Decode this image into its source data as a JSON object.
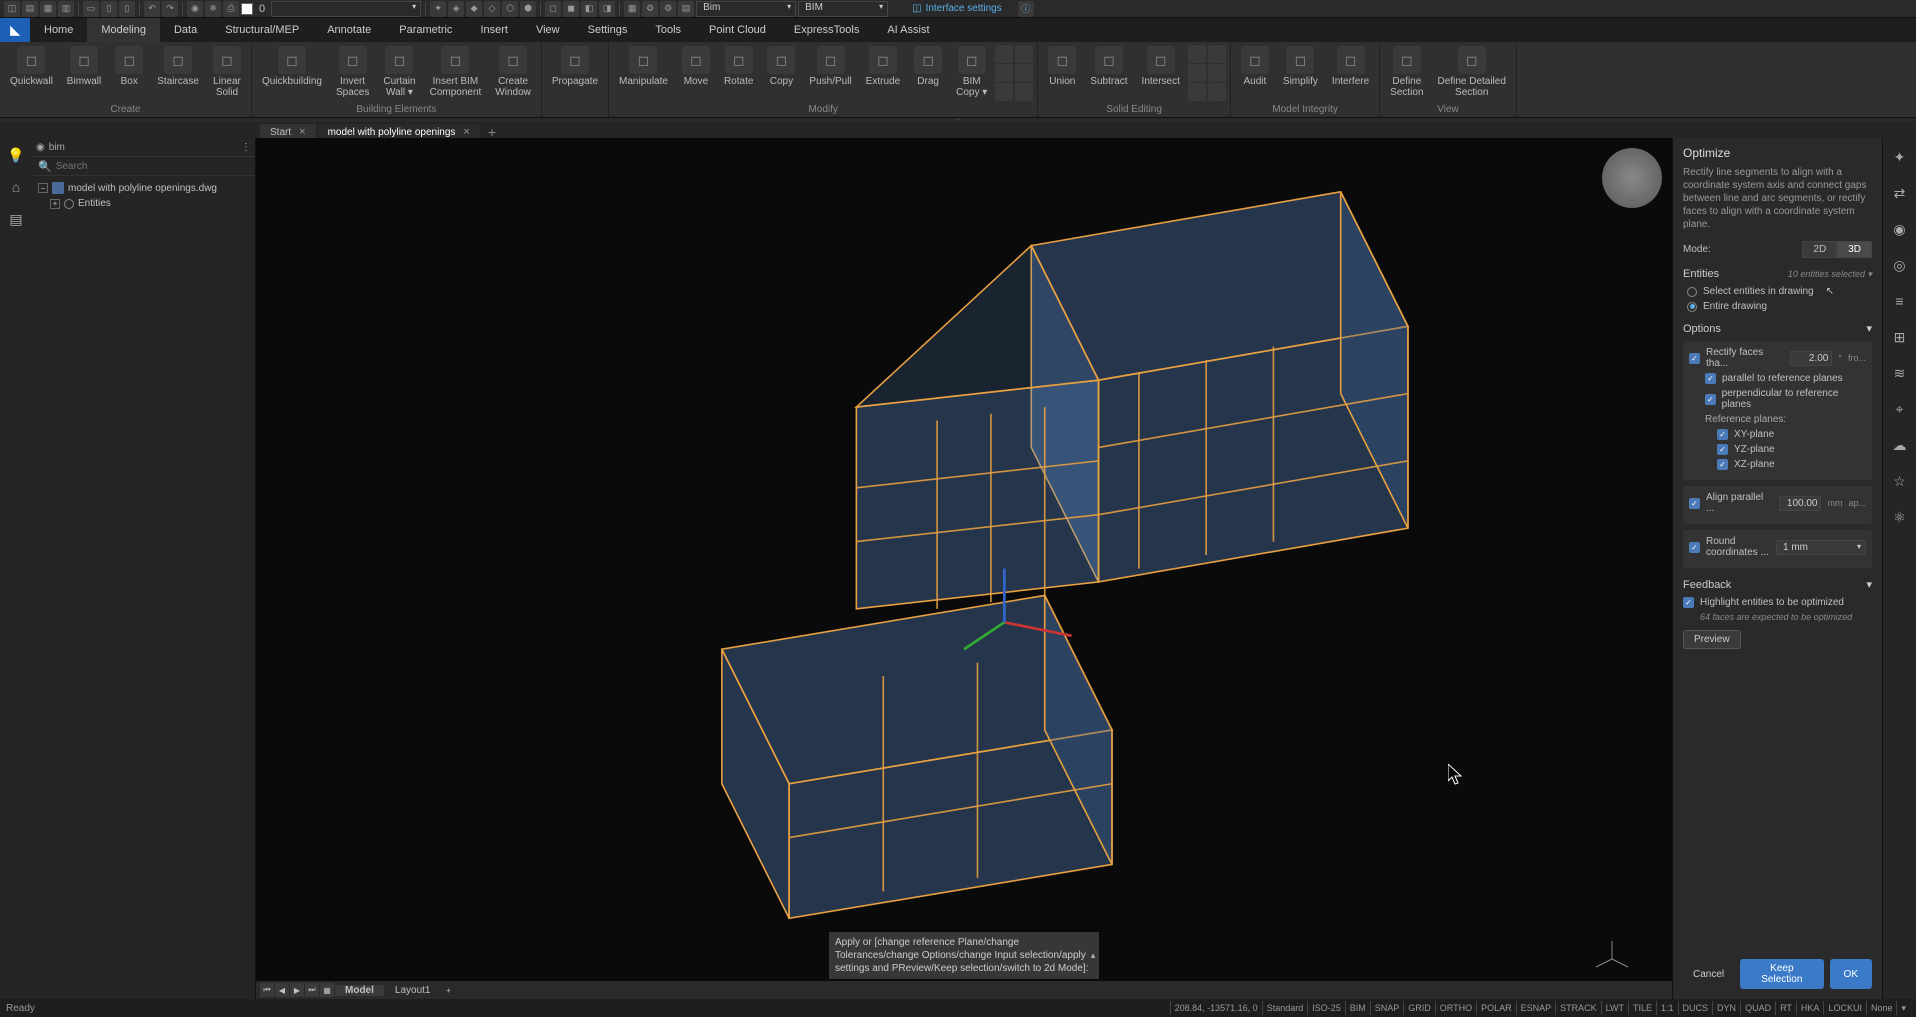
{
  "top": {
    "layer_count": "0",
    "workspace1": "Bim",
    "workspace2": "BIM",
    "interface_settings": "Interface settings"
  },
  "menu": [
    "Home",
    "Modeling",
    "Data",
    "Structural/MEP",
    "Annotate",
    "Parametric",
    "Insert",
    "View",
    "Settings",
    "Tools",
    "Point Cloud",
    "ExpressTools",
    "AI Assist"
  ],
  "menu_active": 1,
  "ribbon": {
    "groups": [
      {
        "label": "Create",
        "items": [
          "Quickwall",
          "Bimwall",
          "Box",
          "Staircase",
          "Linear\nSolid"
        ]
      },
      {
        "label": "Building Elements",
        "items": [
          "Quickbuilding",
          "Invert\nSpaces",
          "Curtain\nWall ▾",
          "Insert BIM\nComponent",
          "Create\nWindow"
        ]
      },
      {
        "label": "",
        "items": [
          "Propagate"
        ]
      },
      {
        "label": "Modify",
        "items": [
          "Manipulate",
          "Move",
          "Rotate",
          "Copy",
          "Push/Pull",
          "Extrude",
          "Drag",
          "BIM\nCopy ▾"
        ]
      },
      {
        "label": "Solid Editing",
        "items": [
          "Union",
          "Subtract",
          "Intersect"
        ]
      },
      {
        "label": "Model Integrity",
        "items": [
          "Audit",
          "Simplify",
          "Interfere"
        ]
      },
      {
        "label": "View",
        "items": [
          "Define\nSection",
          "Define Detailed\nSection"
        ]
      }
    ]
  },
  "doc_tabs": [
    {
      "label": "Start",
      "active": false
    },
    {
      "label": "model with polyline openings",
      "active": true
    }
  ],
  "left_panel": {
    "header": "bim",
    "search_placeholder": "Search",
    "tree_root": "model with polyline openings.dwg",
    "tree_child": "Entities"
  },
  "cmdline": "Apply or [change reference Plane/change Tolerances/change Options/change Input selection/apply settings and PReview/Keep selection/switch to 2d Mode]:",
  "layout": {
    "tabs": [
      "Model",
      "Layout1"
    ],
    "active": 0
  },
  "optimize": {
    "title": "Optimize",
    "desc": "Rectify line segments to align with a coordinate system axis and connect gaps between line and arc segments, or rectify faces to align with a coordinate system plane.",
    "mode_label": "Mode:",
    "mode_2d": "2D",
    "mode_3d": "3D",
    "entities_label": "Entities",
    "entities_hint": "10 entities selected",
    "radio_select": "Select entities in drawing",
    "radio_entire": "Entire drawing",
    "options_label": "Options",
    "rectify_label": "Rectify faces tha...",
    "rectify_value": "2.00",
    "rectify_unit": "°",
    "rectify_suffix": "fro...",
    "parallel": "parallel to reference planes",
    "perpendicular": "perpendicular to reference planes",
    "ref_planes": "Reference planes:",
    "xy": "XY-plane",
    "yz": "YZ-plane",
    "xz": "XZ-plane",
    "align_label": "Align parallel ...",
    "align_value": "100.00",
    "align_unit": "mm",
    "align_suffix": "ap...",
    "round_label": "Round coordinates ...",
    "round_value": "1 mm",
    "feedback_label": "Feedback",
    "highlight": "Highlight entities to be optimized",
    "highlight_hint": "64 faces are expected to be optimized",
    "preview": "Preview",
    "cancel": "Cancel",
    "keep": "Keep Selection",
    "ok": "OK"
  },
  "status": {
    "ready": "Ready",
    "coords": "208.84, -13571.16, 0",
    "items": [
      "Standard",
      "ISO-25",
      "BIM",
      "SNAP",
      "GRID",
      "ORTHO",
      "POLAR",
      "ESNAP",
      "STRACK",
      "LWT",
      "TILE",
      "1:1",
      "DUCS",
      "DYN",
      "QUAD",
      "RT",
      "HKA",
      "LOCKUI",
      "None"
    ]
  }
}
